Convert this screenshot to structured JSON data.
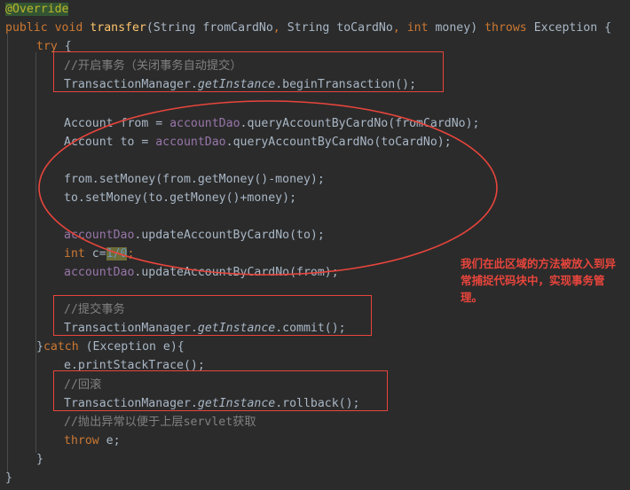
{
  "editor": {
    "background_color": "#2b2b2b",
    "default_text_color": "#a9b7c6",
    "keyword_color": "#cc7832",
    "method_color": "#ffc66d",
    "field_color": "#9876aa",
    "comment_color": "#808080",
    "number_color": "#6897bb",
    "selection_background": "#335533",
    "search_highlight_background": "#6c6c38",
    "annotation_color": "#e8453c"
  },
  "code_lines": [
    {
      "id": "line-annotation-override",
      "text": "@Override"
    },
    {
      "id": "line-method-signature",
      "text": "public void transfer(String fromCardNo, String toCardNo, int money) throws Exception {"
    },
    {
      "id": "line-try-open",
      "text": "try {"
    },
    {
      "id": "line-comment-begin-tx",
      "text": "//开启事务（关闭事务自动提交）"
    },
    {
      "id": "line-begin-transaction",
      "text": "TransactionManager.getInstance().beginTransaction();"
    },
    {
      "id": "line-query-from",
      "text": "Account from = accountDao.queryAccountByCardNo(fromCardNo);"
    },
    {
      "id": "line-query-to",
      "text": "Account to = accountDao.queryAccountByCardNo(toCardNo);"
    },
    {
      "id": "line-set-from-money",
      "text": "from.setMoney(from.getMoney()-money);"
    },
    {
      "id": "line-set-to-money",
      "text": "to.setMoney(to.getMoney()+money);"
    },
    {
      "id": "line-update-to",
      "text": "accountDao.updateAccountByCardNo(to);"
    },
    {
      "id": "line-divide-by-zero",
      "text": "int c=1/0;"
    },
    {
      "id": "line-update-from",
      "text": "accountDao.updateAccountByCardNo(from);"
    },
    {
      "id": "line-comment-commit-tx",
      "text": "//提交事务"
    },
    {
      "id": "line-commit",
      "text": "TransactionManager.getInstance().commit();"
    },
    {
      "id": "line-catch",
      "text": "}catch (Exception e){"
    },
    {
      "id": "line-print-stack-trace",
      "text": "e.printStackTrace();"
    },
    {
      "id": "line-comment-rollback",
      "text": "//回滚"
    },
    {
      "id": "line-rollback",
      "text": "TransactionManager.getInstance().rollback();"
    },
    {
      "id": "line-comment-throw",
      "text": "//抛出异常以便于上层servlet获取"
    },
    {
      "id": "line-throw",
      "text": "throw e;"
    },
    {
      "id": "line-catch-close",
      "text": "}"
    },
    {
      "id": "line-method-close",
      "text": "}"
    }
  ],
  "tokens": {
    "override": "@Override",
    "public": "public",
    "void": "void",
    "transfer": "transfer",
    "open_paren": "(",
    "string_type_1": "String",
    "param_from_card_no": "fromCardNo",
    "comma_1": ", ",
    "string_type_2": "String",
    "param_to_card_no": "toCardNo",
    "comma_2": ", ",
    "int_kw": "int",
    "param_money": "money",
    "close_paren": ")",
    "throws_kw": "throws",
    "exception_type": "Exception",
    "brace_open": "{",
    "try_kw": "try",
    "comment_begin_tx": "//开启事务（关闭事务自动提交）",
    "transaction_manager": "TransactionManager",
    "dot": ".",
    "get_instance": "getInstance",
    "empty_parens": "()",
    "begin_transaction": ".beginTransaction();",
    "account_type": "Account",
    "var_from": " from = ",
    "var_to": " to = ",
    "account_dao": "accountDao",
    "query_from": ".queryAccountByCardNo(fromCardNo);",
    "query_to": ".queryAccountByCardNo(toCardNo);",
    "set_from_money": "from.setMoney(from.getMoney()-money);",
    "set_to_money": "to.setMoney(to.getMoney()+money);",
    "update_to": ".updateAccountByCardNo(to);",
    "update_from": ".updateAccountByCardNo(from);",
    "int_decl": "int",
    "var_c": " c=",
    "divide_expr": "1/0",
    "semicolon": ";",
    "comment_commit": "//提交事务",
    "commit_call": ".commit();",
    "catch_brace": "}",
    "catch_kw": "catch",
    "catch_params": " (Exception e){",
    "print_stack_trace": "e.printStackTrace();",
    "comment_rollback": "//回滚",
    "rollback_call": ".rollback();",
    "comment_throw": "//抛出异常以便于上层servlet获取",
    "throw_kw": "throw",
    "throw_var": " e;",
    "close_brace": "}"
  },
  "annotations": {
    "callout_text": "我们在此区域的方法被放入到异常捕捉代码块中，实现事务管理。",
    "boxes": [
      {
        "id": "box-begin-transaction",
        "label": "begin-transaction-highlight-box"
      },
      {
        "id": "box-commit",
        "label": "commit-highlight-box"
      },
      {
        "id": "box-rollback",
        "label": "rollback-highlight-box"
      }
    ],
    "ellipse": {
      "id": "ellipse-transaction-body",
      "label": "transaction-body-ellipse"
    }
  }
}
